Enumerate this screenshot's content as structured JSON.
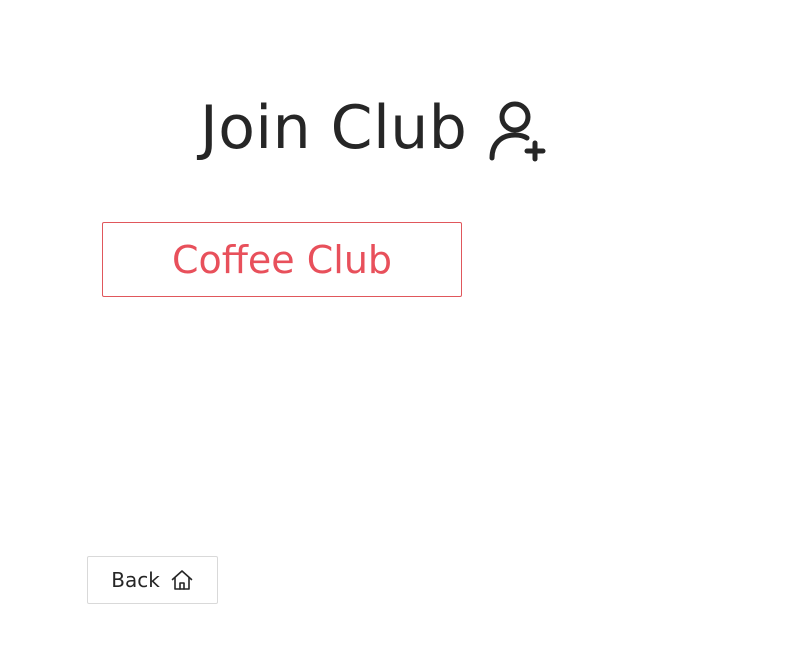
{
  "header": {
    "title": "Join Club",
    "title_icon": "user-add-icon"
  },
  "clubs": [
    {
      "label": "Coffee Club"
    }
  ],
  "footer": {
    "back_label": "Back",
    "back_icon": "home-icon"
  },
  "colors": {
    "text": "#262626",
    "accent": "#e8505b",
    "border_neutral": "#d9d9d9"
  }
}
